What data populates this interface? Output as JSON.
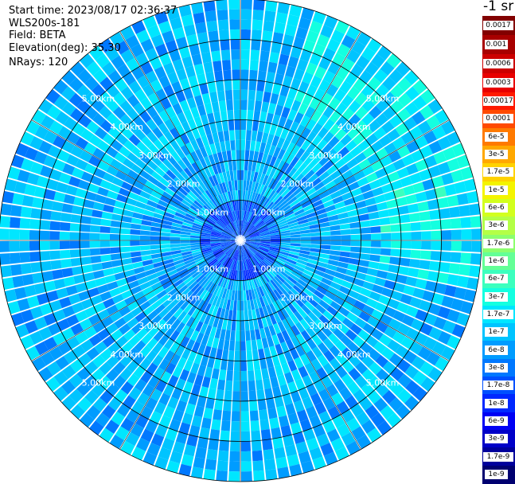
{
  "header": {
    "start_time": "Start time: 2023/08/17 02:36:37",
    "instrument": "WLS200s-181",
    "field": "Field: BETA",
    "elevation": "Elevation(deg): 35.30",
    "nrays": "NRays: 120",
    "unit": "-1 sr"
  },
  "chart_data": {
    "type": "heatmap",
    "projection": "polar-ppi",
    "field": "BETA",
    "elevation_deg": 35.3,
    "n_rays": 120,
    "max_range_km": 6.0,
    "range_rings": [
      {
        "range_km": 1,
        "label": "1.00km"
      },
      {
        "range_km": 2,
        "label": "2.00km"
      },
      {
        "range_km": 3,
        "label": "3.00km"
      },
      {
        "range_km": 4,
        "label": "4.00km"
      },
      {
        "range_km": 5,
        "label": "5.00km"
      },
      {
        "range_km": 6,
        "label": ""
      }
    ],
    "colorbar": {
      "scale": "log",
      "levels": [
        {
          "label": "0.0017",
          "color": "#820000"
        },
        {
          "label": "0.001",
          "color": "#a80000"
        },
        {
          "label": "0.0006",
          "color": "#cc0000"
        },
        {
          "label": "0.0003",
          "color": "#e80000"
        },
        {
          "label": "0.00017",
          "color": "#ff1a00"
        },
        {
          "label": "0.0001",
          "color": "#ff4a00"
        },
        {
          "label": "6e-5",
          "color": "#ff7a00"
        },
        {
          "label": "3e-5",
          "color": "#ffa800"
        },
        {
          "label": "1.7e-5",
          "color": "#ffd200"
        },
        {
          "label": "1e-5",
          "color": "#f4f400"
        },
        {
          "label": "6e-6",
          "color": "#d2ff1e"
        },
        {
          "label": "3e-6",
          "color": "#b4ff46"
        },
        {
          "label": "1.7e-6",
          "color": "#8cff6e"
        },
        {
          "label": "1e-6",
          "color": "#64ff96"
        },
        {
          "label": "6e-7",
          "color": "#3cffbe"
        },
        {
          "label": "3e-7",
          "color": "#14ffe0"
        },
        {
          "label": "1.7e-7",
          "color": "#00e6ff"
        },
        {
          "label": "1e-7",
          "color": "#00c4ff"
        },
        {
          "label": "6e-8",
          "color": "#009cff"
        },
        {
          "label": "3e-8",
          "color": "#0078ff"
        },
        {
          "label": "1.7e-8",
          "color": "#0050ff"
        },
        {
          "label": "1e-8",
          "color": "#0028ff"
        },
        {
          "label": "6e-9",
          "color": "#0000f4"
        },
        {
          "label": "3e-9",
          "color": "#0000c8"
        },
        {
          "label": "1.7e-9",
          "color": "#00009c"
        },
        {
          "label": "1e-9",
          "color": "#000070"
        }
      ]
    }
  }
}
